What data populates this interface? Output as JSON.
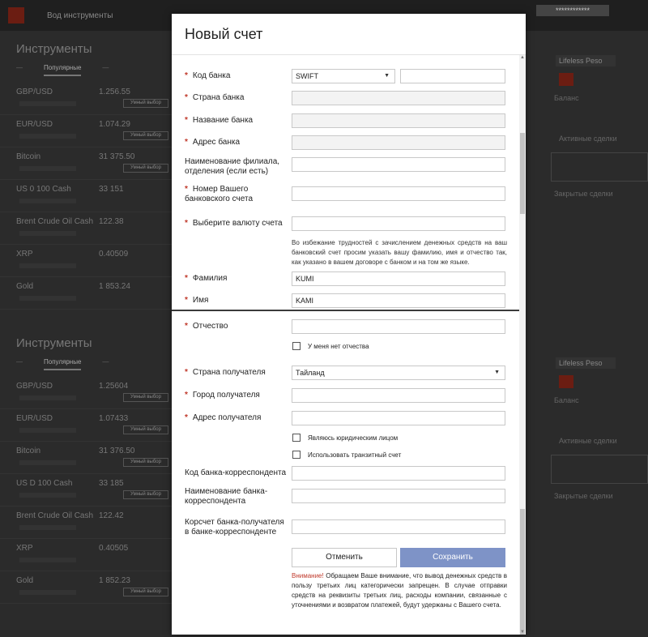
{
  "background": {
    "topbar_tab": "Вод инструменты",
    "user_mask": "************",
    "panel_title": "Инструменты",
    "tab_popular": "Популярные",
    "rows_top": [
      {
        "symbol": "GBP/USD",
        "price": "1.256.55",
        "button": "Умный выбор"
      },
      {
        "symbol": "EUR/USD",
        "price": "1.074.29",
        "button": "Умный выбор"
      },
      {
        "symbol": "Bitcoin",
        "price": "31 375.50",
        "button": "Умный выбор"
      },
      {
        "symbol": "US 0 100 Cash",
        "price": "33 151",
        "button": ""
      },
      {
        "symbol": "Brent Crude Oil Cash",
        "price": "122.38",
        "button": ""
      },
      {
        "symbol": "XRP",
        "price": "0.40509",
        "button": ""
      },
      {
        "symbol": "Gold",
        "price": "1 853.24",
        "button": ""
      }
    ],
    "rows_bottom": [
      {
        "symbol": "GBP/USD",
        "price": "1.25604",
        "button": "Умный выбор"
      },
      {
        "symbol": "EUR/USD",
        "price": "1.07433",
        "button": "Умный выбор"
      },
      {
        "symbol": "Bitcoin",
        "price": "31 376.50",
        "button": "Умный выбор"
      },
      {
        "symbol": "US D 100 Cash",
        "price": "33 185",
        "button": "Умный выбор"
      },
      {
        "symbol": "Brent Crude Oil Cash",
        "price": "122.42",
        "button": ""
      },
      {
        "symbol": "XRP",
        "price": "0.40505",
        "button": ""
      },
      {
        "symbol": "Gold",
        "price": "1 852.23",
        "button": "Умный выбор"
      }
    ],
    "right_box": "Lifeless Peso",
    "right_balance": "Баланс",
    "right_closed": "Закрытые сделки",
    "right_active": "Активные сделки"
  },
  "modal": {
    "title": "Новый счет",
    "fields": {
      "bank_code": {
        "label": "Код банка",
        "select_value": "SWIFT",
        "value": ""
      },
      "bank_country": {
        "label": "Страна банка",
        "value": ""
      },
      "bank_name": {
        "label": "Название банка",
        "value": ""
      },
      "bank_address": {
        "label": "Адрес банка",
        "value": ""
      },
      "branch_name": {
        "label": "Наименование филиала, отделения (если есть)",
        "value": ""
      },
      "account_number": {
        "label": "Номер Вашего банковского счета",
        "value": ""
      },
      "currency": {
        "label": "Выберите валюту счета",
        "value": ""
      },
      "currency_note": "Во избежание трудностей с зачислением денежных средств на ваш банковский счет просим указать вашу фамилию, имя и отчество так, как указано в вашем договоре с банком и на том же языке.",
      "last_name": {
        "label": "Фамилия",
        "value": "KUMI"
      },
      "first_name": {
        "label": "Имя",
        "value": "KAMI"
      },
      "patronymic": {
        "label": "Отчество",
        "value": ""
      },
      "no_patronymic": "У меня нет отчества",
      "recipient_country": {
        "label": "Страна получателя",
        "value": "Тайланд"
      },
      "recipient_city": {
        "label": "Город получателя",
        "value": ""
      },
      "recipient_address": {
        "label": "Адрес получателя",
        "value": ""
      },
      "is_legal_entity": "Являюсь юридическим лицом",
      "use_transit": "Использовать транзитный счет",
      "corr_bank_code": {
        "label": "Код банка-корреспондента",
        "value": ""
      },
      "corr_bank_name": {
        "label": "Наименование банка-корреспондента",
        "value": ""
      },
      "corr_account": {
        "label": "Корсчет банка-получателя в банке-корреспонденте",
        "value": ""
      }
    },
    "cancel_label": "Отменить",
    "save_label": "Сохранить",
    "warning_accent": "Внимание!",
    "warning_text": " Обращаем Ваше внимание, что вывод денежных средств в пользу третьих лиц категорически запрещен. В случае отправки средств на реквизиты третьих лиц, расходы компании, связанные с уточнениями и возвратом платежей, будут удержаны с Вашего счета.",
    "required_mark": "*"
  }
}
